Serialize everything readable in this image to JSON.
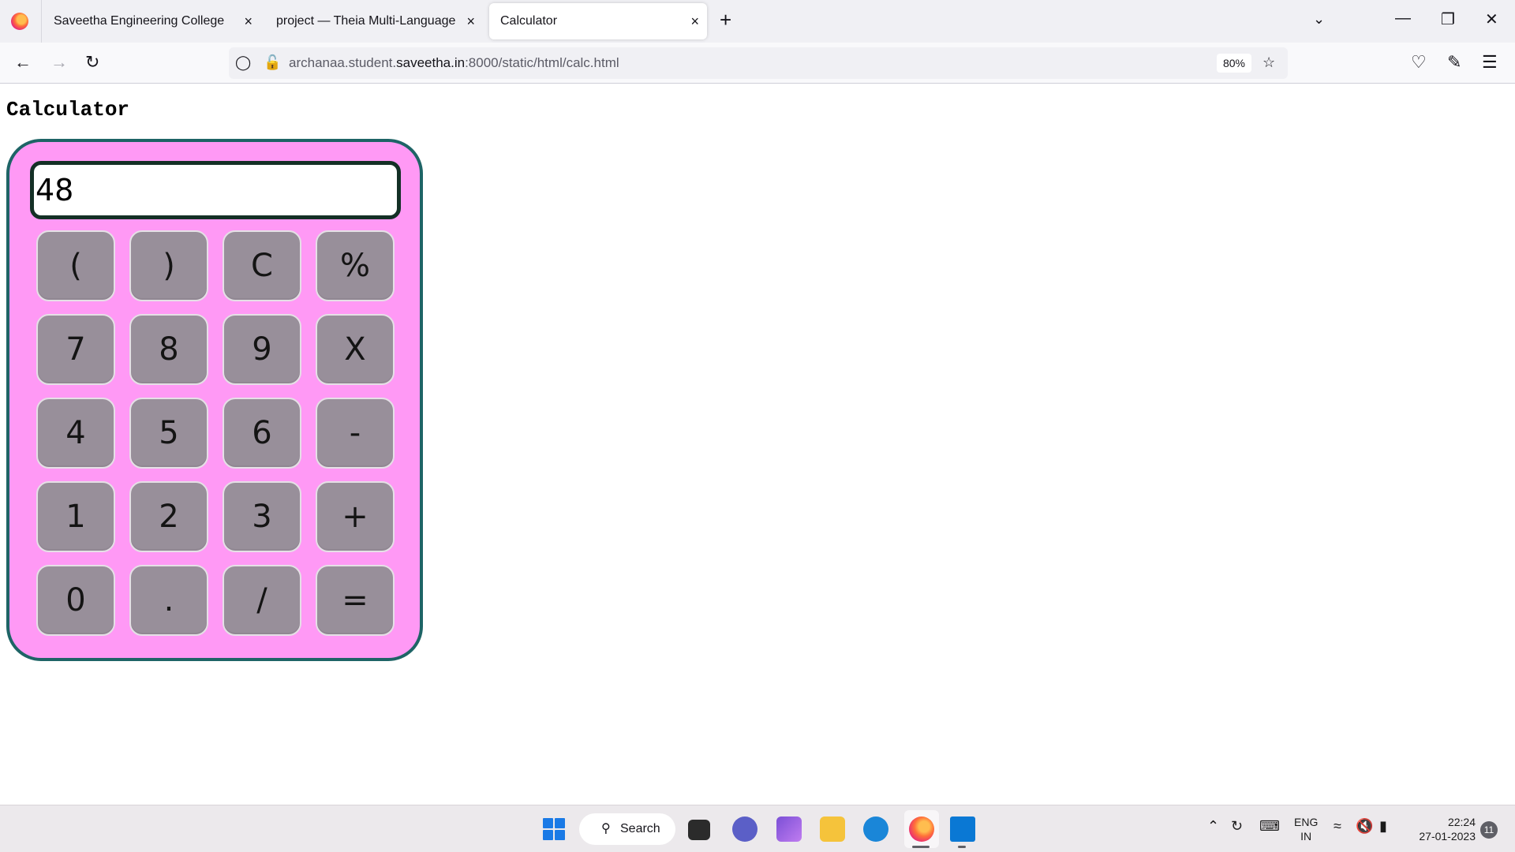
{
  "browser": {
    "tabs": [
      {
        "title": "Saveetha Engineering College"
      },
      {
        "title": "project — Theia Multi-Language Ex"
      },
      {
        "title": "Calculator"
      }
    ],
    "close_glyph": "×",
    "new_tab_glyph": "+",
    "url_prefix": "archanaa.student.",
    "url_host": "saveetha.in",
    "url_suffix": ":8000/static/html/calc.html",
    "zoom": "80%"
  },
  "page": {
    "title": "Calculator",
    "display_value": "48",
    "keys": [
      "(",
      ")",
      "C",
      "%",
      "7",
      "8",
      "9",
      "X",
      "4",
      "5",
      "6",
      "-",
      "1",
      "2",
      "3",
      "+",
      "0",
      ".",
      "/",
      "="
    ]
  },
  "taskbar": {
    "search_label": "Search",
    "lang_line1": "ENG",
    "lang_line2": "IN",
    "time": "22:24",
    "date": "27-01-2023",
    "notification_count": "11"
  },
  "colors": {
    "calc_body": "#ff99f5",
    "calc_border": "#1e6466",
    "key_bg": "#988f9a"
  }
}
